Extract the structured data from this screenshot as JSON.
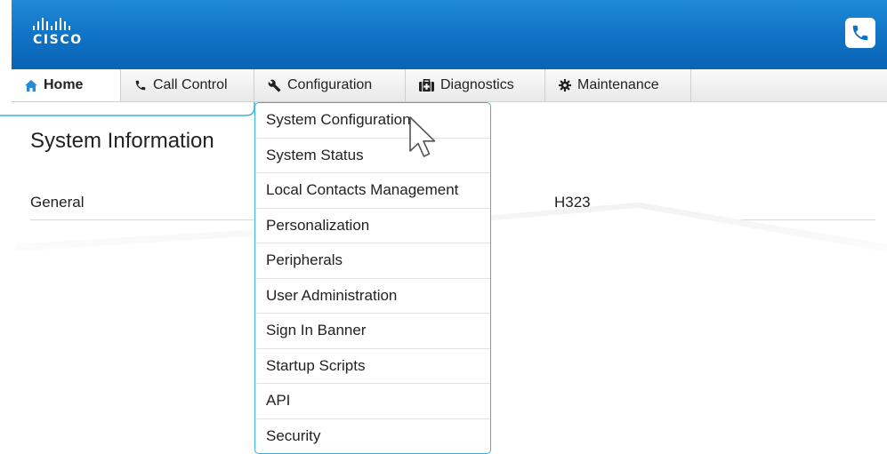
{
  "header": {
    "logo_text": "CISCO",
    "brand_color": "#0f72c4",
    "call_icon": "phone-icon"
  },
  "nav": {
    "tabs": [
      {
        "label": "Home",
        "icon": "home-icon",
        "active": true
      },
      {
        "label": "Call Control",
        "icon": "phone-icon"
      },
      {
        "label": "Configuration",
        "icon": "wrench-icon"
      },
      {
        "label": "Diagnostics",
        "icon": "medkit-icon"
      },
      {
        "label": "Maintenance",
        "icon": "gear-icon"
      }
    ]
  },
  "main": {
    "title": "System Information",
    "section": "General",
    "column": "H323"
  },
  "dropdown": {
    "accent_color": "#35b4e0",
    "items": [
      "System Configuration",
      "System Status",
      "Local Contacts Management",
      "Personalization",
      "Peripherals",
      "User Administration",
      "Sign In Banner",
      "Startup Scripts",
      "API",
      "Security"
    ]
  }
}
